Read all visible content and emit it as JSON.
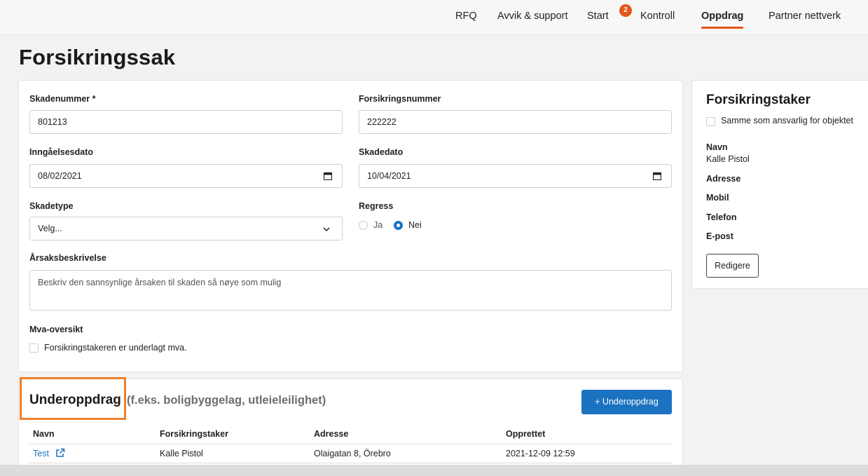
{
  "nav": {
    "items": [
      {
        "label": "RFQ"
      },
      {
        "label": "Avvik & support"
      },
      {
        "label": "Start",
        "badge": "2"
      },
      {
        "label": "Kontroll"
      },
      {
        "label": "Oppdrag",
        "active": true
      },
      {
        "label": "Partner nettverk"
      }
    ]
  },
  "page": {
    "title": "Forsikringssak"
  },
  "form": {
    "skadenummer": {
      "label": "Skadenummer *",
      "value": "801213"
    },
    "forsikringsnummer": {
      "label": "Forsikringsnummer",
      "value": "222222"
    },
    "inngaelsesdato": {
      "label": "Inngåelsesdato",
      "value": "08/02/2021"
    },
    "skadedato": {
      "label": "Skadedato",
      "value": "10/04/2021"
    },
    "skadetype": {
      "label": "Skadetype",
      "value": "Velg..."
    },
    "regress": {
      "label": "Regress",
      "options": [
        "Ja",
        "Nei"
      ],
      "selected": "Nei"
    },
    "arsak": {
      "label": "Årsaksbeskrivelse",
      "placeholder": "Beskriv den sannsynlige årsaken til skaden så nøye som mulig"
    },
    "mva": {
      "label": "Mva-oversikt",
      "checkbox_label": "Forsikringstakeren er underlagt mva."
    }
  },
  "sidepanel": {
    "title": "Forsikringstaker",
    "same_checkbox": "Samme som ansvarlig for objektet",
    "navn_label": "Navn",
    "navn_value": "Kalle Pistol",
    "adresse_label": "Adresse",
    "mobil_label": "Mobil",
    "telefon_label": "Telefon",
    "epost_label": "E-post",
    "edit_button": "Redigere"
  },
  "underoppdrag": {
    "title": "Underoppdrag",
    "subtitle": "(f.eks. boligbyggelag, utleieleilighet)",
    "add_button": "+ Underoppdrag",
    "columns": [
      "Navn",
      "Forsikringstaker",
      "Adresse",
      "Opprettet"
    ],
    "rows": [
      {
        "navn": "Test",
        "forsikringstaker": "Kalle Pistol",
        "adresse": "Olaigatan 8, Örebro",
        "opprettet": "2021-12-09 12:59"
      }
    ]
  },
  "colors": {
    "accent": "#e4561b",
    "primary": "#1b72c0",
    "highlight": "#f07f2a"
  }
}
